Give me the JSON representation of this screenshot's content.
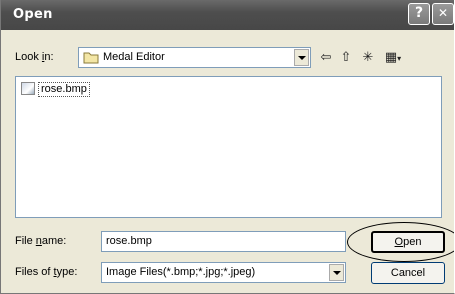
{
  "window": {
    "title": "Open",
    "help_label": "?",
    "close_label": "✕"
  },
  "look_in": {
    "label_prefix": "Look ",
    "label_accel": "i",
    "label_suffix": "n:",
    "value": "Medal Editor"
  },
  "toolbar": {
    "back_icon": "⇦",
    "up_icon": "⇧",
    "new_folder_icon": "✳",
    "view_icon": "▦"
  },
  "files": [
    {
      "name": "rose.bmp"
    }
  ],
  "file_name": {
    "label_prefix": "File ",
    "label_accel": "n",
    "label_suffix": "ame:",
    "value": "rose.bmp"
  },
  "file_type": {
    "label_prefix": "Files of ",
    "label_accel": "t",
    "label_suffix": "ype:",
    "value": "Image Files(*.bmp;*.jpg;*.jpeg)"
  },
  "buttons": {
    "open_accel": "O",
    "open_rest": "pen",
    "cancel": "Cancel"
  }
}
